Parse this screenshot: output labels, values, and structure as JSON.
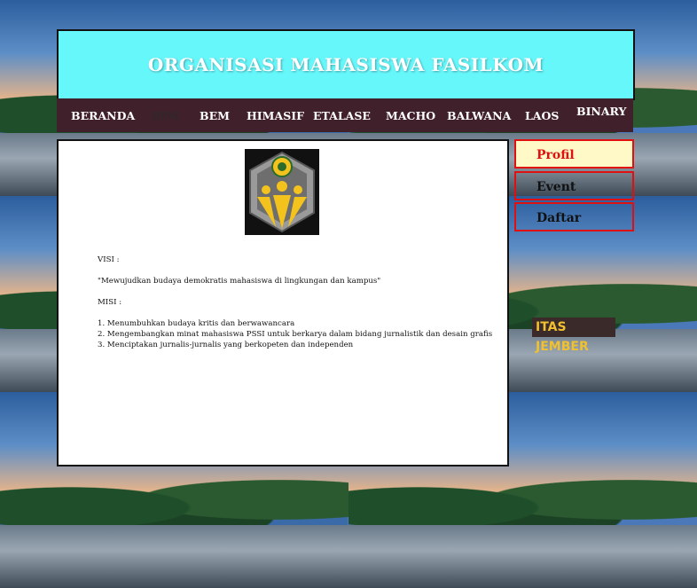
{
  "header": {
    "title": "ORGANISASI MAHASISWA FASILKOM"
  },
  "nav": {
    "items": [
      {
        "label": "BERANDA"
      },
      {
        "label": "BPM"
      },
      {
        "label": "BEM"
      },
      {
        "label": "HIMASIF"
      },
      {
        "label": "ETALASE"
      },
      {
        "label": "MACHO"
      },
      {
        "label": "BALWANA"
      },
      {
        "label": "LAOS"
      },
      {
        "label": "BINARY"
      }
    ]
  },
  "background": {
    "sign_text": "ITAS JEMBER"
  },
  "content": {
    "logo_icon": "bpm-logo-icon",
    "visi_label": "VISI :",
    "visi_text": "\"Mewujudkan budaya demokratis mahasiswa di lingkungan dan kampus\"",
    "misi_label": "MISI :",
    "misi_items": [
      "1. Menumbuhkan budaya kritis dan berwawancara",
      "2. Mengembangkan minat mahasiswa PSSI untuk berkarya dalam bidang jurnalistik dan desain grafis",
      "3. Menciptakan jurnalis-jurnalis yang berkopeten dan independen"
    ]
  },
  "sidebar": {
    "items": [
      {
        "label": "Profil",
        "active": true
      },
      {
        "label": "Event",
        "active": false
      },
      {
        "label": "Daftar",
        "active": false
      }
    ]
  },
  "colors": {
    "header_bg": "#66f7fb",
    "nav_bg": "#40202a",
    "sidebar_border": "#e01010",
    "sidebar_active_bg": "#fff9c8",
    "logo_yellow": "#f4c21c"
  }
}
